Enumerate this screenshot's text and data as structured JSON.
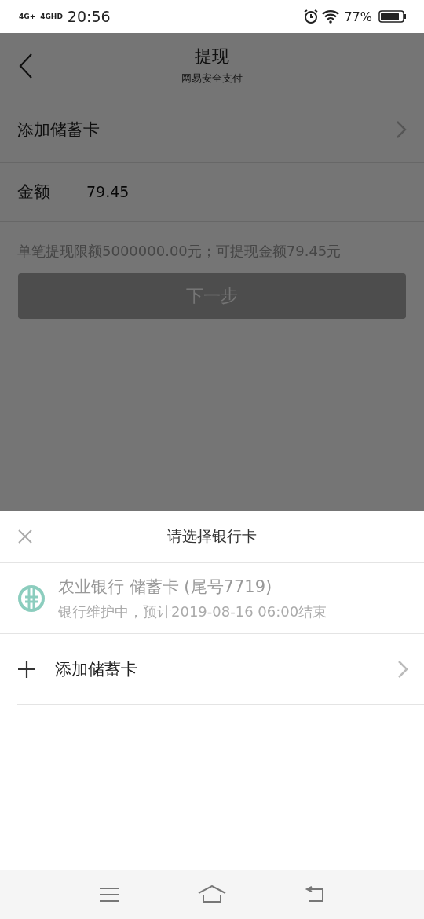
{
  "status_bar": {
    "network_1": "4G+",
    "network_2": "4GHD",
    "time": "20:56",
    "battery": "77%"
  },
  "header": {
    "title": "提现",
    "subtitle": "网易安全支付"
  },
  "form": {
    "add_card_label": "添加储蓄卡",
    "amount_label": "金额",
    "amount_value": "79.45",
    "hint": "单笔提现限额5000000.00元；可提现金额79.45元",
    "next_button": {
      "label": "下一步",
      "disabled": true
    }
  },
  "sheet": {
    "title": "请选择银行卡",
    "items": [
      {
        "kind": "bank",
        "name": "农业银行 储蓄卡 (尾号7719)",
        "note": "银行维护中，预计2019-08-16 06:00结束",
        "disabled": true
      },
      {
        "kind": "add",
        "label": "添加储蓄卡"
      }
    ]
  }
}
